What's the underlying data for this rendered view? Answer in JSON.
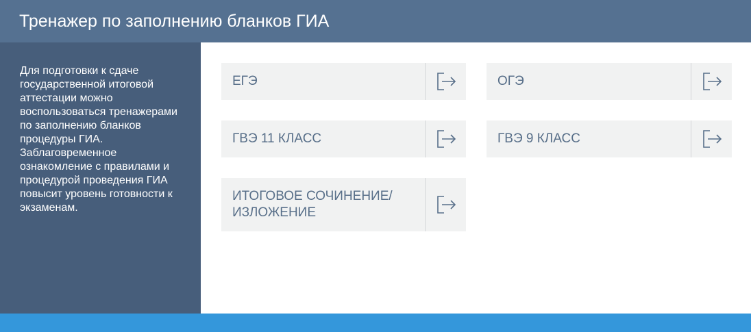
{
  "header": {
    "title": "Тренажер по заполнению бланков ГИА"
  },
  "sidebar": {
    "description": "Для подготовки к сдаче государственной итоговой аттестации можно воспользоваться тренажерами по заполнению бланков процедуры ГИА. Заблаговременное ознакомление с правилами и процедурой проведения ГИА повысит уровень готовности к экзаменам."
  },
  "cards": [
    {
      "label": "ЕГЭ",
      "icon": "exit-arrow-icon"
    },
    {
      "label": "ОГЭ",
      "icon": "exit-arrow-icon"
    },
    {
      "label": "ГВЭ 11 КЛАСС",
      "icon": "exit-arrow-icon"
    },
    {
      "label": "ГВЭ 9 КЛАСС",
      "icon": "exit-arrow-icon"
    },
    {
      "label": "ИТОГОВОЕ СОЧИНЕНИЕ/ ИЗЛОЖЕНИЕ",
      "icon": "exit-arrow-icon"
    }
  ],
  "colors": {
    "header_bg": "#557191",
    "sidebar_bg": "#475e7b",
    "card_bg": "#f1f2f2",
    "card_text": "#586f89",
    "footer_bg": "#3497db"
  }
}
